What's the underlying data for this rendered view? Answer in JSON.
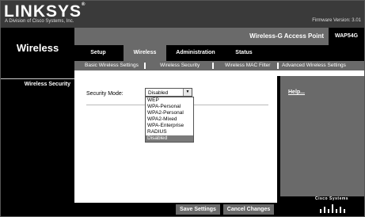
{
  "header": {
    "logo": "LINKSYS",
    "logo_mark": "®",
    "sublogo": "A Division of Cisco Systems, Inc.",
    "firmware": "Firmware Version: 3.01"
  },
  "product": {
    "name": "Wireless-G Access Point",
    "model": "WAP54G"
  },
  "section": {
    "title": "Wireless",
    "sub": "Wireless Security"
  },
  "tabs": [
    {
      "label": "Setup"
    },
    {
      "label": "Wireless"
    },
    {
      "label": "Administration"
    },
    {
      "label": "Status"
    }
  ],
  "subtabs": [
    {
      "label": "Basic Wireless Settings"
    },
    {
      "label": "Wireless Security"
    },
    {
      "label": "Wireless MAC Filter"
    },
    {
      "label": "Advanced Wireless Settings"
    }
  ],
  "form": {
    "mode_label": "Security Mode:",
    "mode_value": "Disabled",
    "options": [
      "WEP",
      "WPA-Personal",
      "WPA2-Personal",
      "WPA2-Mixed",
      "WPA-Enterprise",
      "RADIUS",
      "Disabled"
    ]
  },
  "help": {
    "link": "Help..."
  },
  "brand": {
    "cisco": "Cisco Systems"
  },
  "footer": {
    "save": "Save Settings",
    "cancel": "Cancel Changes"
  },
  "colors": {
    "dark": "#000000",
    "mid": "#6a6a6a",
    "header": "#3a3a3a"
  }
}
